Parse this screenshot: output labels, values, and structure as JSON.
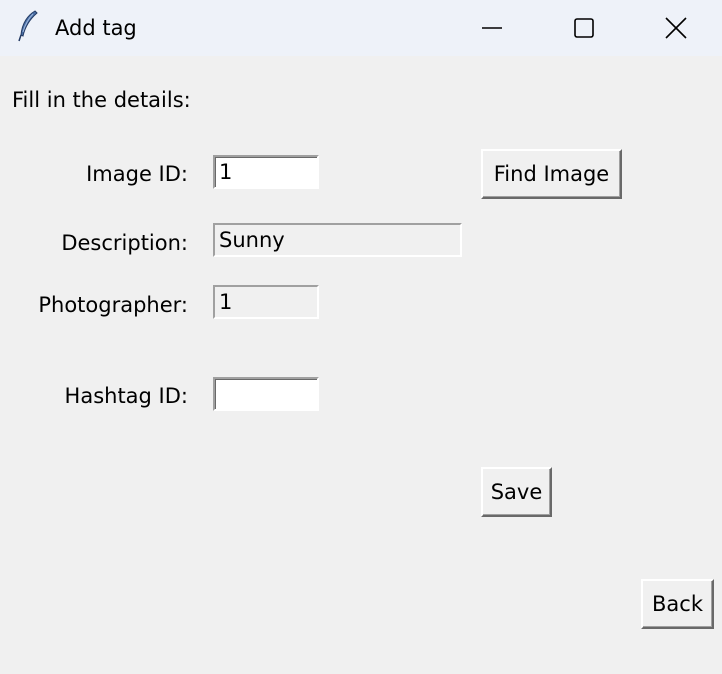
{
  "window": {
    "title": "Add tag",
    "icon": "feather-icon",
    "controls": {
      "minimize_icon": "minimize-icon",
      "maximize_icon": "maximize-icon",
      "close_icon": "close-icon"
    }
  },
  "form": {
    "instructions": "Fill in the details:",
    "image_id": {
      "label": "Image ID:",
      "value": "1"
    },
    "description": {
      "label": "Description:",
      "value": "Sunny"
    },
    "photographer": {
      "label": "Photographer:",
      "value": "1"
    },
    "hashtag_id": {
      "label": "Hashtag ID:",
      "value": ""
    }
  },
  "buttons": {
    "find_image": "Find Image",
    "save": "Save",
    "back": "Back"
  }
}
